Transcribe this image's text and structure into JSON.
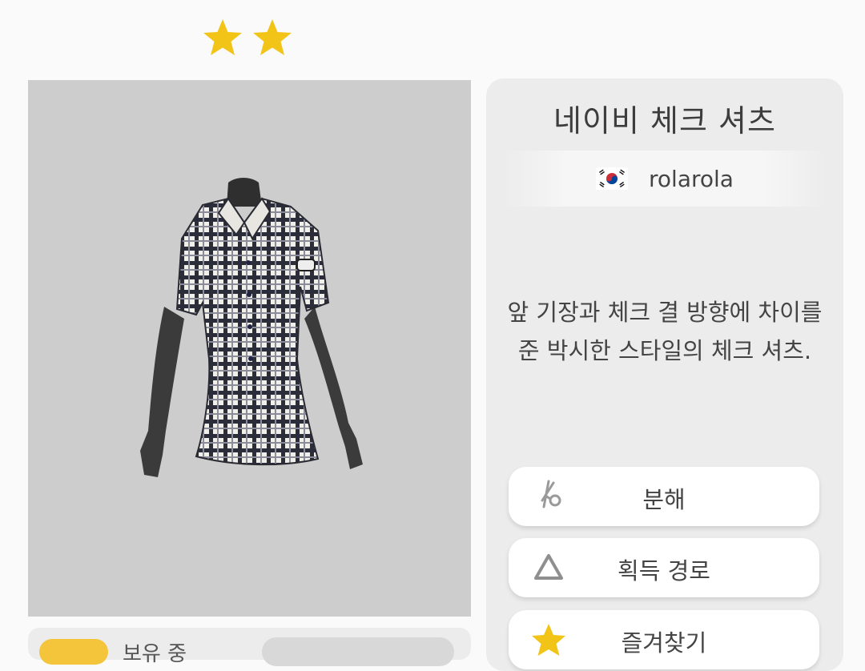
{
  "rarity": {
    "stars": 2,
    "star_color": "#f2c418"
  },
  "item": {
    "name": "네이비 체크 셔츠",
    "creator": {
      "flag_icon": "korea-flag-icon",
      "name": "rolarola"
    },
    "description_line1": "앞 기장과 체크 결 방향에 차이를",
    "description_line2": "준 박시한 스타일의 체크 셔츠."
  },
  "actions": {
    "disassemble": {
      "label": "분해",
      "icon": "scissors-icon"
    },
    "source": {
      "label": "획득 경로",
      "icon": "triangle-icon"
    },
    "favorite": {
      "label": "즐겨찾기",
      "icon": "star-icon"
    }
  },
  "bottom": {
    "owned_label": "보유 중"
  },
  "colors": {
    "item_bg": "#cdcdcd",
    "panel_bg": "#ececec",
    "accent_yellow": "#f4c53a"
  }
}
